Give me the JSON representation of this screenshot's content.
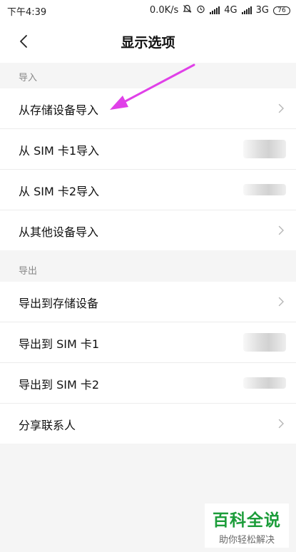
{
  "status_bar": {
    "time": "下午4:39",
    "speed": "0.0K/s",
    "network1": "4G",
    "network2": "3G",
    "battery": "76"
  },
  "header": {
    "title": "显示选项"
  },
  "import_section": {
    "title": "导入",
    "items": [
      {
        "label": "从存储设备导入"
      },
      {
        "label": "从 SIM 卡1导入"
      },
      {
        "label": "从 SIM 卡2导入"
      },
      {
        "label": "从其他设备导入"
      }
    ]
  },
  "export_section": {
    "title": "导出",
    "items": [
      {
        "label": "导出到存储设备"
      },
      {
        "label": "导出到 SIM 卡1"
      },
      {
        "label": "导出到 SIM 卡2"
      },
      {
        "label": "分享联系人"
      }
    ]
  },
  "watermark": {
    "title": "百科全说",
    "subtitle": "助你轻松解决"
  },
  "colors": {
    "annotation_arrow": "#e040e8",
    "watermark_green": "#1c9d3a"
  }
}
